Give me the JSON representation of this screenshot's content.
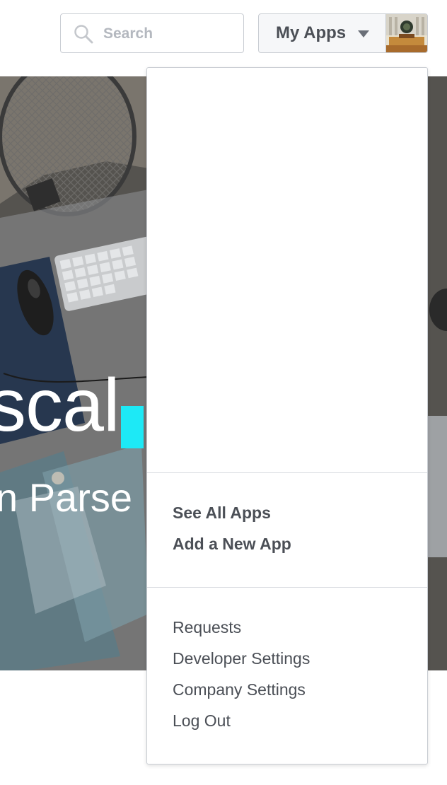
{
  "header": {
    "search": {
      "placeholder": "Search",
      "value": "",
      "icon": "search-icon"
    },
    "my_apps": {
      "label": "My Apps",
      "icon": "chevron-down-icon"
    }
  },
  "hero": {
    "headline": "scal",
    "subline": "n Parse",
    "accent_color": "#1de9f6"
  },
  "dropdown": {
    "app_actions": [
      {
        "label": "See All Apps"
      },
      {
        "label": "Add a New App"
      }
    ],
    "account_links": [
      {
        "label": "Requests"
      },
      {
        "label": "Developer Settings"
      },
      {
        "label": "Company Settings"
      },
      {
        "label": "Log Out"
      }
    ]
  },
  "colors": {
    "text_dark": "#4b4f56",
    "border": "#c9cdd3",
    "placeholder": "#b4b8bf"
  }
}
